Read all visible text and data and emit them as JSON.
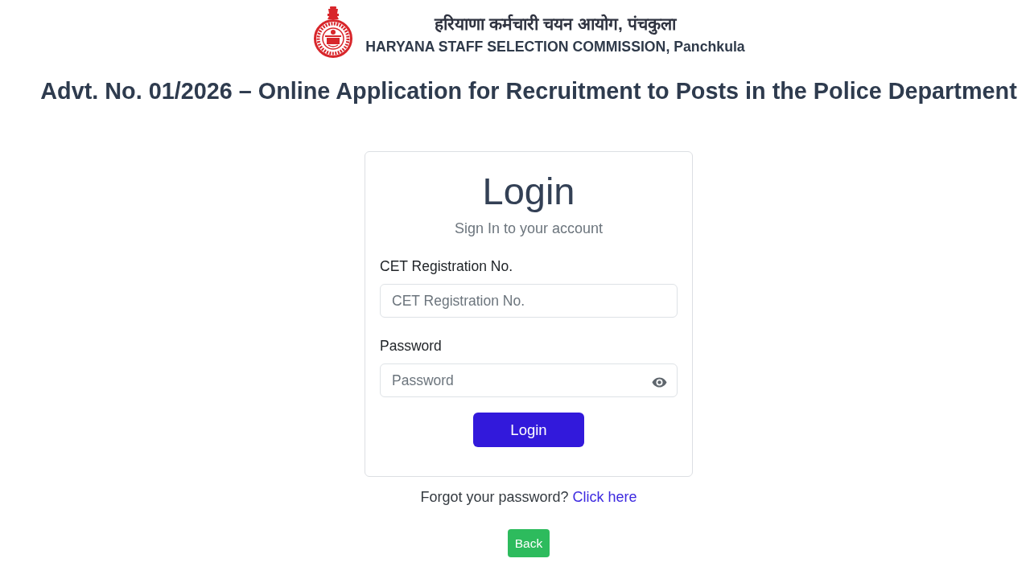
{
  "header": {
    "title_hindi": "हरियाणा कर्मचारी चयन आयोग, पंचकुला",
    "title_english": "HARYANA STAFF SELECTION COMMISSION, Panchkula"
  },
  "page_title": "Advt. No. 01/2026 – Online Application for Recruitment to Posts in the Police Department",
  "login_card": {
    "heading": "Login",
    "subtitle": "Sign In to your account",
    "fields": [
      {
        "kind": "text",
        "label": "CET Registration No.",
        "placeholder": "CET Registration No."
      },
      {
        "kind": "password",
        "label": "Password",
        "placeholder": "Password"
      }
    ],
    "submit_button": "Login"
  },
  "forgot_password": {
    "text": "Forgot your password?",
    "link": "Click here"
  },
  "back_button": "Back"
}
